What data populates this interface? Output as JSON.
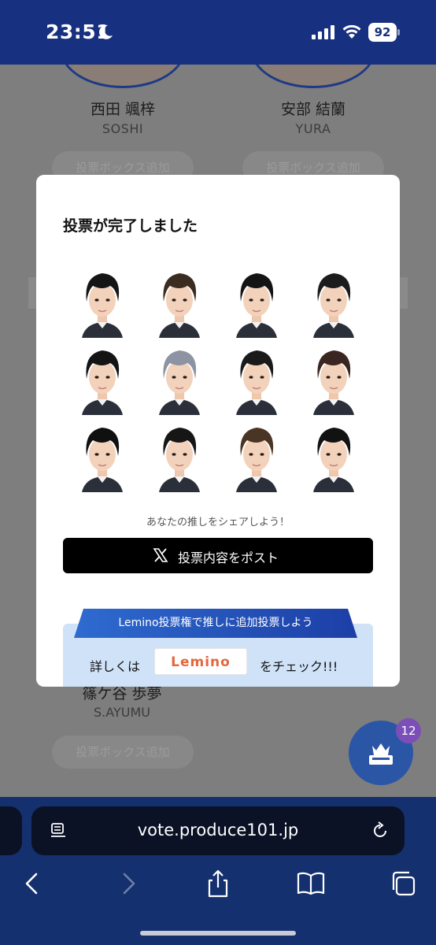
{
  "status_bar": {
    "time": "23:51",
    "battery": "92"
  },
  "background": {
    "candidates_top": [
      {
        "name": "西田 颯梓",
        "roman": "SOSHI",
        "button": "投票ボックス追加"
      },
      {
        "name": "安部 結蘭",
        "roman": "YURA",
        "button": "投票ボックス追加"
      }
    ],
    "candidate_bottom": {
      "name": "篠ケ谷 歩夢",
      "roman": "S.AYUMU",
      "button": "投票ボックス追加"
    },
    "vote_box_badge": "12"
  },
  "modal": {
    "title": "投票が完了しました",
    "faces": [
      {
        "hair": "#151515"
      },
      {
        "hair": "#3b2c22"
      },
      {
        "hair": "#141414"
      },
      {
        "hair": "#1c1c1c"
      },
      {
        "hair": "#141414"
      },
      {
        "hair": "#8d93a3"
      },
      {
        "hair": "#1a1a1a"
      },
      {
        "hair": "#3a2620"
      },
      {
        "hair": "#101010"
      },
      {
        "hair": "#161616"
      },
      {
        "hair": "#4a3524"
      },
      {
        "hair": "#121212"
      }
    ],
    "share_caption": "あなたの推しをシェアしよう！",
    "post_button": "投票内容をポスト",
    "promo": {
      "ribbon": "Lemino投票権で推しに追加投票しよう",
      "prefix": "詳しくは",
      "logo": "Lemino",
      "suffix": "をチェック!!!"
    }
  },
  "browser": {
    "url": "vote.produce101.jp"
  },
  "colors": {
    "status_bar": "#17307f",
    "safari_bar": "#15306e",
    "ribbon": "#2253b8",
    "promo_panel": "#cfe2f7",
    "fab": "#2b56a6",
    "badge": "#7c4fb8",
    "lemino_logo": "#e4673b"
  }
}
